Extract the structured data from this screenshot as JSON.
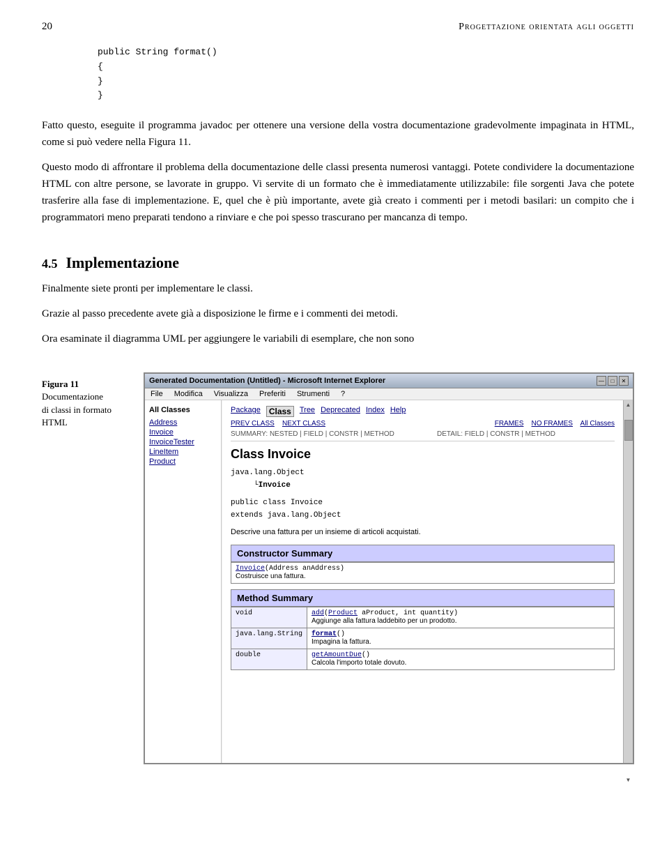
{
  "page": {
    "number": "20",
    "title": "Progettazione orientata agli oggetti"
  },
  "code": {
    "line1": "public String format()",
    "line2": "{",
    "line3": "}",
    "line4": "}"
  },
  "paragraphs": {
    "p1": "Fatto questo, eseguite il programma javadoc per ottenere una versione della vostra documentazione gradevolmente impaginata in HTML, come si può vedere nella Figura 11.",
    "p2": "Questo modo di affrontare il problema della documentazione delle classi presenta numerosi vantaggi. Potete condividere la documentazione HTML con altre persone, se lavorate in gruppo. Vi servite di un formato che è immediatamente utilizzabile: file sorgenti Java che potete trasferire alla fase di implementazione. E, quel che è più importante, avete già creato i commenti per i metodi basilari: un compito che i programmatori meno preparati tendono a rinviare e che poi spesso trascurano per mancanza di tempo."
  },
  "section": {
    "number": "4.5",
    "title": "Implementazione",
    "p1": "Finalmente siete pronti per implementare le classi.",
    "p2": "Grazie al passo precedente avete già a disposizione le firme e i commenti dei metodi.",
    "p3": "Ora esaminate il diagramma UML per aggiungere le variabili di esemplare, che non sono"
  },
  "figure": {
    "label": "Figura 11",
    "caption1": "Documentazione",
    "caption2": "di classi in formato",
    "caption3": "HTML"
  },
  "browser": {
    "title": "Generated Documentation (Untitled) - Microsoft Internet Explorer",
    "menu_items": [
      "File",
      "Modifica",
      "Visualizza",
      "Preferiti",
      "Strumenti",
      "?"
    ],
    "titlebar_buttons": [
      "—",
      "□",
      "✕"
    ],
    "sidebar": {
      "header": "All Classes",
      "links": [
        "Address",
        "Invoice",
        "InvoiceTester",
        "LineItem",
        "Product"
      ]
    },
    "main": {
      "nav_items": [
        "Package",
        "Class",
        "Tree",
        "Deprecated",
        "Index",
        "Help"
      ],
      "class_active": "Class",
      "prev_next": "PREV CLASS   NEXT CLASS",
      "frames_label": "FRAMES   NO FRAMES   All Classes",
      "summary_line": "SUMMARY: NESTED | FIELD | CONSTR | METHOD",
      "detail_line": "DETAIL: FIELD | CONSTR | METHOD",
      "class_title": "Class Invoice",
      "inheritance1": "java.lang.Object",
      "inheritance2": "     └Invoice",
      "code1": "public class Invoice",
      "code2": "extends java.lang.Object",
      "class_desc": "Descrive una fattura per un insieme di articoli acquistati.",
      "constructor_summary_header": "Constructor Summary",
      "constructor_table": [
        {
          "signature": "Invoice(Address anAddress)",
          "description": "Costruisce una fattura."
        }
      ],
      "method_summary_header": "Method Summary",
      "method_table": [
        {
          "type": "void",
          "signature": "add(Product aProduct, int quantity)",
          "description": "Aggiunge alla fattura laddebito per un prodotto."
        },
        {
          "type": "java.lang.String",
          "signature": "format()",
          "description": "Impagina la fattura."
        },
        {
          "type": "double",
          "signature": "getAmountDue()",
          "description": "Calcola l'importo totale dovuto."
        }
      ]
    }
  }
}
